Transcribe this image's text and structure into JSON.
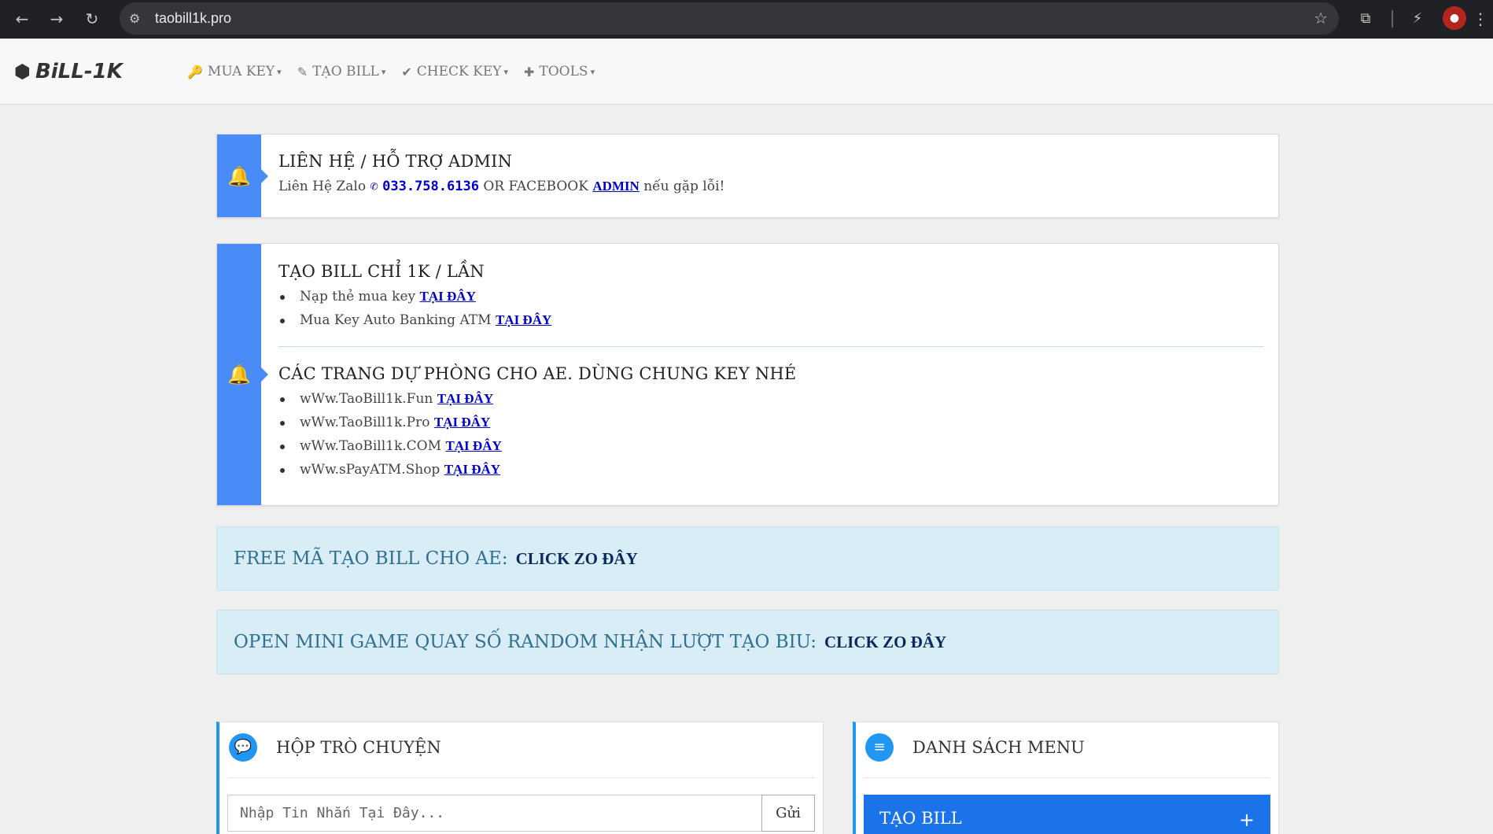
{
  "browser": {
    "url": "taobill1k.pro",
    "back_icon": "←",
    "forward_icon": "→",
    "reload_icon": "↻",
    "tune_icon": "⚙",
    "star_icon": "☆",
    "extensions_icon": "⧉",
    "performance_icon": "⚡",
    "avatar_icon": "●",
    "menu_icon": "⋮"
  },
  "navbar": {
    "brand_icon": "⬢",
    "brand": "BiLL-1K",
    "items": [
      {
        "icon": "🔑",
        "label": "MUA KEY"
      },
      {
        "icon": "✎",
        "label": "TẠO BILL"
      },
      {
        "icon": "✔",
        "label": "CHECK KEY"
      },
      {
        "icon": "✚",
        "label": "TOOLS"
      }
    ],
    "caret": "▾"
  },
  "contact_card": {
    "bell_icon": "🔔",
    "title": "LIÊN HỆ / HỖ TRỢ ADMIN",
    "prefix": "Liên Hệ Zalo",
    "phone_icon": "✆",
    "phone": "033.758.6136",
    "middle": "OR FACEBOOK",
    "admin_link": "ADMIN",
    "suffix": "nếu gặp lỗi!"
  },
  "bill_card": {
    "bell_icon": "🔔",
    "title": "TẠO BILL CHỈ 1K / LẦN",
    "items": [
      {
        "text": "Nạp thẻ mua key",
        "link": "TẠI ĐÂY"
      },
      {
        "text": "Mua Key Auto Banking ATM",
        "link": "TẠI ĐÂY"
      }
    ],
    "backup_title": "CÁC TRANG DỰ PHÒNG CHO AE. DÙNG CHUNG KEY NHÉ",
    "backup_items": [
      {
        "text": "wWw.TaoBill1k.Fun",
        "link": "TẠI ĐÂY"
      },
      {
        "text": "wWw.TaoBill1k.Pro",
        "link": "TẠI ĐÂY"
      },
      {
        "text": "wWw.TaoBill1k.COM",
        "link": "TẠI ĐÂY"
      },
      {
        "text": "wWw.sPayATM.Shop",
        "link": "TẠI ĐÂY"
      }
    ]
  },
  "free_alert": {
    "text": "FREE MÃ TẠO BILL CHO AE:",
    "link": "CLICK ZO ĐÂY"
  },
  "game_alert": {
    "text": "OPEN MINI GAME QUAY SỐ RANDOM NHẬN LƯỢT TẠO BIU:",
    "link": "CLICK ZO ĐÂY"
  },
  "chat_panel": {
    "icon": "💬",
    "title": "HỘP TRÒ CHUYỆN",
    "placeholder": "Nhập Tin Nhắn Tại Đây...",
    "send": "Gửi"
  },
  "menu_panel": {
    "icon": "≡",
    "title": "DANH SÁCH MENU",
    "first_item": "TẠO BILL",
    "plus": "+"
  }
}
